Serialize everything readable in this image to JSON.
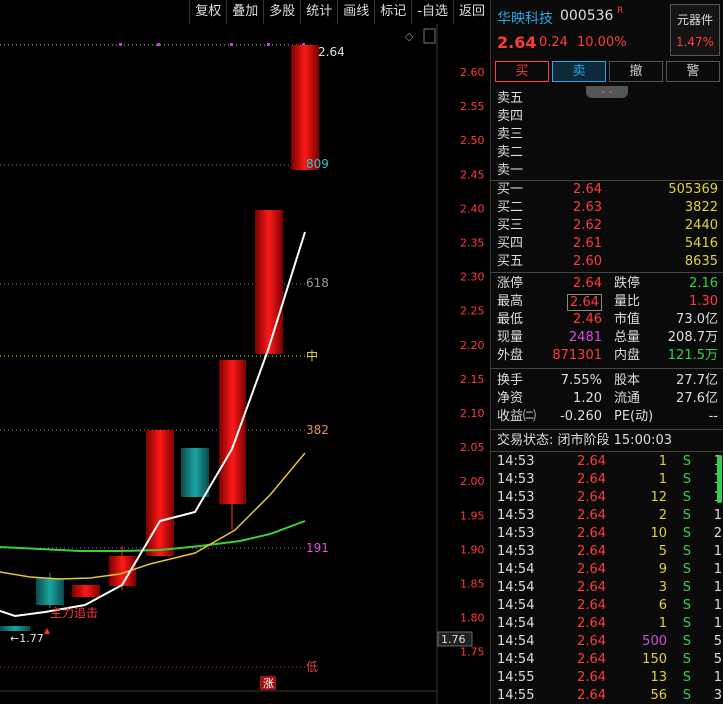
{
  "toolbar": [
    "复权",
    "叠加",
    "多股",
    "统计",
    "画线",
    "标记",
    "-自选",
    "返回"
  ],
  "chart": {
    "price_axis": [
      "2.60",
      "2.55",
      "2.50",
      "2.45",
      "2.40",
      "2.35",
      "2.30",
      "2.25",
      "2.20",
      "2.15",
      "2.10",
      "2.05",
      "2.00",
      "1.95",
      "1.90",
      "1.85",
      "1.80",
      "1.75"
    ],
    "level_labels": {
      "top": "2.64",
      "l809": "809",
      "l618": "618",
      "mid": "中",
      "l382": "382",
      "l191": "191",
      "low": "低"
    },
    "annotations": {
      "low_marker": "←1.77",
      "signal_text": "主力追击",
      "limit_tag": "涨"
    },
    "cursor_price": "1.76"
  },
  "header": {
    "name": "华映科技",
    "code": "000536",
    "flag": "R",
    "price": "2.64",
    "change": "0.24",
    "change_pct": "10.00%",
    "sector_name": "元器件",
    "sector_pct": "1.47%"
  },
  "actions": [
    "买",
    "卖",
    "撤",
    "警"
  ],
  "asks": [
    {
      "label": "卖五",
      "price": "",
      "vol": ""
    },
    {
      "label": "卖四",
      "price": "",
      "vol": ""
    },
    {
      "label": "卖三",
      "price": "",
      "vol": ""
    },
    {
      "label": "卖二",
      "price": "",
      "vol": ""
    },
    {
      "label": "卖一",
      "price": "",
      "vol": ""
    }
  ],
  "bids": [
    {
      "label": "买一",
      "price": "2.64",
      "vol": "505369"
    },
    {
      "label": "买二",
      "price": "2.63",
      "vol": "3822"
    },
    {
      "label": "买三",
      "price": "2.62",
      "vol": "2440"
    },
    {
      "label": "买四",
      "price": "2.61",
      "vol": "5416"
    },
    {
      "label": "买五",
      "price": "2.60",
      "vol": "8635"
    }
  ],
  "stats": [
    {
      "l1": "涨停",
      "v1": "2.64",
      "l2": "跌停",
      "v2": "2.16"
    },
    {
      "l1": "最高",
      "v1": "2.64",
      "l2": "量比",
      "v2": "1.30"
    },
    {
      "l1": "最低",
      "v1": "2.46",
      "l2": "市值",
      "v2": "73.0亿"
    },
    {
      "l1": "现量",
      "v1": "2481",
      "l2": "总量",
      "v2": "208.7万"
    },
    {
      "l1": "外盘",
      "v1": "871301",
      "l2": "内盘",
      "v2": "121.5万"
    }
  ],
  "fundamentals": [
    {
      "l1": "换手",
      "v1": "7.55%",
      "l2": "股本",
      "v2": "27.7亿"
    },
    {
      "l1": "净资",
      "v1": "1.20",
      "l2": "流通",
      "v2": "27.6亿"
    },
    {
      "l1": "收益㈡",
      "v1": "-0.260",
      "l2": "PE(动)",
      "v2": "--"
    }
  ],
  "trade_status": "交易状态: 闭市阶段 15:00:03",
  "ticks": [
    {
      "time": "14:53",
      "price": "2.64",
      "vol": "1",
      "side": "S",
      "n": "1"
    },
    {
      "time": "14:53",
      "price": "2.64",
      "vol": "1",
      "side": "S",
      "n": "1"
    },
    {
      "time": "14:53",
      "price": "2.64",
      "vol": "12",
      "side": "S",
      "n": "1"
    },
    {
      "time": "14:53",
      "price": "2.64",
      "vol": "2",
      "side": "S",
      "n": "1"
    },
    {
      "time": "14:53",
      "price": "2.64",
      "vol": "10",
      "side": "S",
      "n": "2"
    },
    {
      "time": "14:53",
      "price": "2.64",
      "vol": "5",
      "side": "S",
      "n": "1"
    },
    {
      "time": "14:54",
      "price": "2.64",
      "vol": "9",
      "side": "S",
      "n": "1"
    },
    {
      "time": "14:54",
      "price": "2.64",
      "vol": "3",
      "side": "S",
      "n": "1"
    },
    {
      "time": "14:54",
      "price": "2.64",
      "vol": "6",
      "side": "S",
      "n": "1"
    },
    {
      "time": "14:54",
      "price": "2.64",
      "vol": "1",
      "side": "S",
      "n": "1"
    },
    {
      "time": "14:54",
      "price": "2.64",
      "vol": "500",
      "side": "S",
      "n": "5"
    },
    {
      "time": "14:54",
      "price": "2.64",
      "vol": "150",
      "side": "S",
      "n": "5"
    },
    {
      "time": "14:55",
      "price": "2.64",
      "vol": "13",
      "side": "S",
      "n": "1"
    },
    {
      "time": "14:55",
      "price": "2.64",
      "vol": "56",
      "side": "S",
      "n": "3"
    }
  ],
  "colors": {
    "up": "#ff3b3b",
    "down": "#1a8c8c",
    "buy_side": "#35d04a",
    "ma_short": "#ffffff",
    "ma_mid": "#e0c830",
    "ma_long": "#3ad03a"
  }
}
